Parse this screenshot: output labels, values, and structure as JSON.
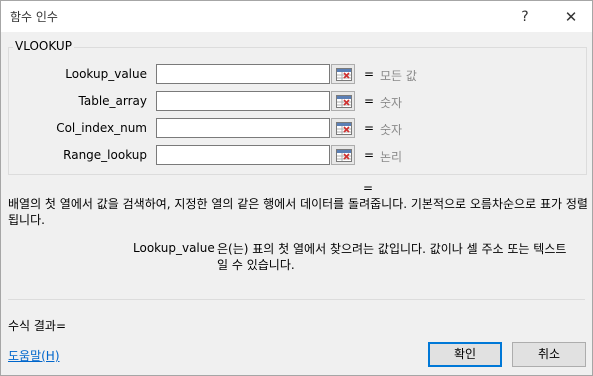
{
  "window": {
    "title": "함수 인수",
    "help_glyph": "?",
    "close_glyph": "✕"
  },
  "function_name": "VLOOKUP",
  "arguments": [
    {
      "label": "Lookup_value",
      "input": "",
      "eq": "=",
      "value": "모든 값"
    },
    {
      "label": "Table_array",
      "input": "",
      "eq": "=",
      "value": "숫자"
    },
    {
      "label": "Col_index_num",
      "input": "",
      "eq": "=",
      "value": "숫자"
    },
    {
      "label": "Range_lookup",
      "input": "",
      "eq": "=",
      "value": "논리"
    }
  ],
  "result_eq": "=",
  "description": "배열의 첫 열에서 값을 검색하여, 지정한 열의 같은 행에서 데이터를 돌려줍니다. 기본적으로 오름차순으로 표가 정렬됩니다.",
  "arg_help": {
    "name": "Lookup_value",
    "text": "은(는) 표의 첫 열에서 찾으려는 값입니다. 값이나 셀 주소 또는 텍스트일 수 있습니다."
  },
  "formula_result": "수식 결과=",
  "help_link": "도움말(H)",
  "buttons": {
    "ok": "확인",
    "cancel": "취소"
  },
  "icons": {
    "collapse": "range-select-icon"
  },
  "colors": {
    "ok_border": "#0078d7",
    "link": "#0066cc",
    "hint": "#8a8a8a"
  }
}
